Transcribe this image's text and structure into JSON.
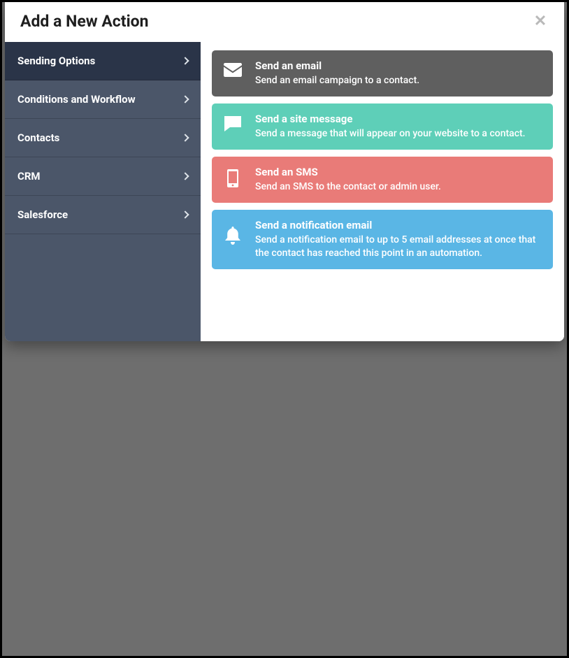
{
  "modal": {
    "title": "Add a New Action"
  },
  "sidebar": {
    "items": [
      {
        "label": "Sending Options",
        "active": true
      },
      {
        "label": "Conditions and Workflow",
        "active": false
      },
      {
        "label": "Contacts",
        "active": false
      },
      {
        "label": "CRM",
        "active": false
      },
      {
        "label": "Salesforce",
        "active": false
      }
    ]
  },
  "actions": [
    {
      "id": "send-email",
      "icon": "envelope-icon",
      "title": "Send an email",
      "desc": "Send an email campaign to a contact.",
      "colorClass": "card-gray"
    },
    {
      "id": "send-site-message",
      "icon": "chat-icon",
      "title": "Send a site message",
      "desc": "Send a message that will appear on your website to a contact.",
      "colorClass": "card-teal"
    },
    {
      "id": "send-sms",
      "icon": "phone-icon",
      "title": "Send an SMS",
      "desc": "Send an SMS to the contact or admin user.",
      "colorClass": "card-red"
    },
    {
      "id": "send-notification",
      "icon": "bell-icon",
      "title": "Send a notification email",
      "desc": "Send a notification email to up to 5 email addresses at once that the contact has reached this point in an automation.",
      "colorClass": "card-blue"
    }
  ]
}
